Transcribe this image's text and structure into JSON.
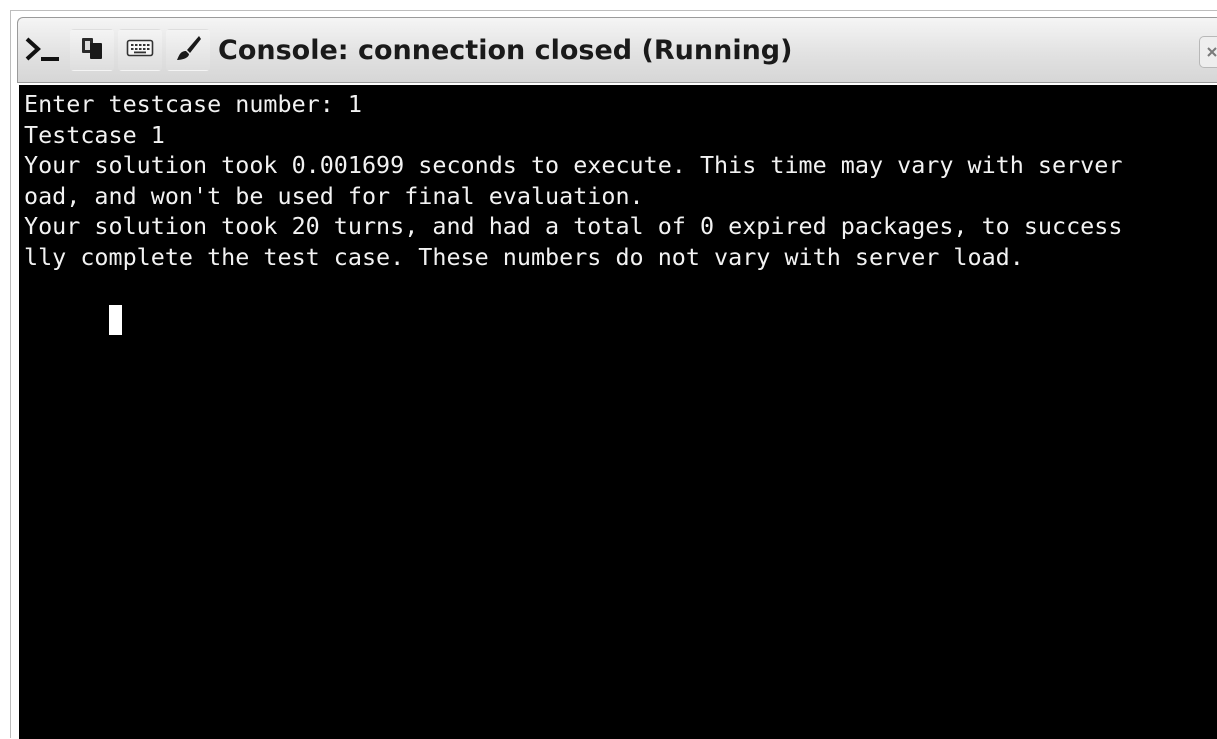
{
  "window": {
    "title": "Console: connection closed (Running)"
  },
  "toolbar": {
    "icons": [
      "terminal-prompt-icon",
      "copy-icon",
      "keyboard-icon",
      "clear-brush-icon",
      "close-icon"
    ]
  },
  "console": {
    "lines": [
      "Enter testcase number: 1",
      "Testcase 1",
      "Your solution took 0.001699 seconds to execute. This time may vary with server",
      "oad, and won't be used for final evaluation.",
      "Your solution took 20 turns, and had a total of 0 expired packages, to success",
      "lly complete the test case. These numbers do not vary with server load."
    ]
  },
  "colors": {
    "terminal_background": "#000000",
    "terminal_text": "#f2f2f2",
    "titlebar": "#e2e2e2"
  }
}
